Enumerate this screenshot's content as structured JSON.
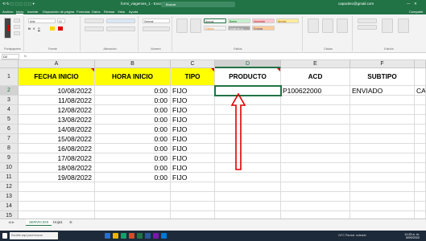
{
  "titlebar": {
    "quick_access": "⟲ ↻ ⬚ ⬚ ⬚ ⬚ ⬚ ▾",
    "file_title": "formi_viagemes_1 - Excel",
    "search": "Buscar",
    "user": "capacitec@gmail.com"
  },
  "ribbon_tabs": [
    "Archivo",
    "Inicio",
    "Insertar",
    "Disposición de página",
    "Fórmulas",
    "Datos",
    "Revisar",
    "Vista",
    "Ayuda"
  ],
  "ribbon_share": "Compartir",
  "ribbon": {
    "font_name": "Arial",
    "font_size": "10",
    "number_format": "General",
    "style_normal": "Normal",
    "style_bueno": "Bueno",
    "style_incorrecto": "Incorrecto",
    "style_neutral": "Neutral",
    "style_calculo": "Cálculo",
    "style_celda": "Celda de co...",
    "style_entrada": "Entrada",
    "group_portapapeles": "Portapapeles",
    "group_fuente": "Fuente",
    "group_alineacion": "Alineación",
    "group_numero": "Número",
    "group_estilos": "Estilos",
    "group_celdas": "Celdas",
    "group_edicion": "Edición"
  },
  "formula_bar": {
    "name_box": "D2",
    "fx": "fx"
  },
  "columns": [
    "A",
    "B",
    "C",
    "D",
    "E",
    "F"
  ],
  "selected_column": "D",
  "rows": [
    "1",
    "2",
    "3",
    "4",
    "5",
    "6",
    "7",
    "8",
    "9",
    "10",
    "11",
    "12",
    "13",
    "14",
    "15"
  ],
  "headers": [
    "FECHA INICIO",
    "HORA INICIO",
    "TIPO",
    "PRODUCTO",
    "ACD",
    "SUBTIPO"
  ],
  "data": [
    {
      "fecha": "10/08/2022",
      "hora": "0:00",
      "tipo": "FIJO",
      "acd": "P100622000",
      "subtipo": "ENVIADO",
      "g": "CA"
    },
    {
      "fecha": "11/08/2022",
      "hora": "0:00",
      "tipo": "FIJO"
    },
    {
      "fecha": "12/08/2022",
      "hora": "0:00",
      "tipo": "FIJO"
    },
    {
      "fecha": "13/08/2022",
      "hora": "0:00",
      "tipo": "FIJO"
    },
    {
      "fecha": "14/08/2022",
      "hora": "0:00",
      "tipo": "FIJO"
    },
    {
      "fecha": "15/08/2022",
      "hora": "0:00",
      "tipo": "FIJO"
    },
    {
      "fecha": "16/08/2022",
      "hora": "0:00",
      "tipo": "FIJO"
    },
    {
      "fecha": "17/08/2022",
      "hora": "0:00",
      "tipo": "FIJO"
    },
    {
      "fecha": "18/08/2022",
      "hora": "0:00",
      "tipo": "FIJO"
    },
    {
      "fecha": "19/08/2022",
      "hora": "0:00",
      "tipo": "FIJO"
    }
  ],
  "sheets": [
    "SERVICIOS",
    "Hoja1"
  ],
  "active_sheet": "SERVICIOS",
  "taskbar": {
    "search": "Escribe aquí para buscar",
    "clock": "11:25 a. m.",
    "date": "5/09/2022",
    "weather": "24°C Parcial. soleado"
  },
  "colors": {
    "accent": "#217346",
    "header_fill": "#ffff00",
    "arrow": "#e00000",
    "comment_marker": "#d00000"
  }
}
